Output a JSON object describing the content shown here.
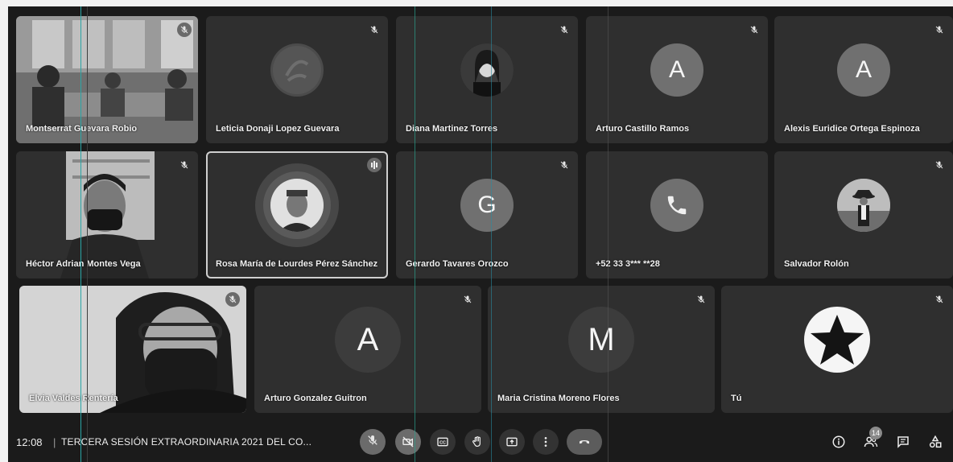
{
  "tiles": [
    {
      "name": "Montserrat Guevara Robio"
    },
    {
      "name": "Leticia Donaji Lopez Guevara"
    },
    {
      "name": "Diana Martinez Torres"
    },
    {
      "name": "Arturo Castillo Ramos",
      "initial": "A"
    },
    {
      "name": "Alexis Euridice Ortega Espinoza",
      "initial": "A"
    },
    {
      "name": "Héctor Adrian Montes Vega"
    },
    {
      "name": "Rosa María de Lourdes Pérez Sánchez"
    },
    {
      "name": "Gerardo Tavares Orozco",
      "initial": "G"
    },
    {
      "name": "+52 33 3*** **28"
    },
    {
      "name": "Salvador Rolón"
    },
    {
      "name": "Elvia Valdes Rentería"
    },
    {
      "name": "Arturo Gonzalez Guitron",
      "initial": "A"
    },
    {
      "name": "Maria Cristina Moreno Flores",
      "initial": "M"
    },
    {
      "name": "Tú"
    }
  ],
  "bottom_bar": {
    "time": "12:08",
    "separator": "|",
    "meeting_title": "TERCERA SESIÓN EXTRAORDINARIA 2021 DEL CO...",
    "participant_count": "14"
  },
  "icons": {
    "mic": "mic-off-icon",
    "camera": "camera-off-icon",
    "captions": "captions-icon",
    "hand": "raise-hand-icon",
    "present": "present-screen-icon",
    "more": "more-options-icon",
    "hangup": "end-call-icon",
    "info": "info-icon",
    "people": "people-icon",
    "chat": "chat-icon",
    "activities": "activities-icon"
  },
  "colors": {
    "background": "#1b1b1b",
    "tile": "#2f2f2f",
    "text": "#f2f2f2"
  }
}
